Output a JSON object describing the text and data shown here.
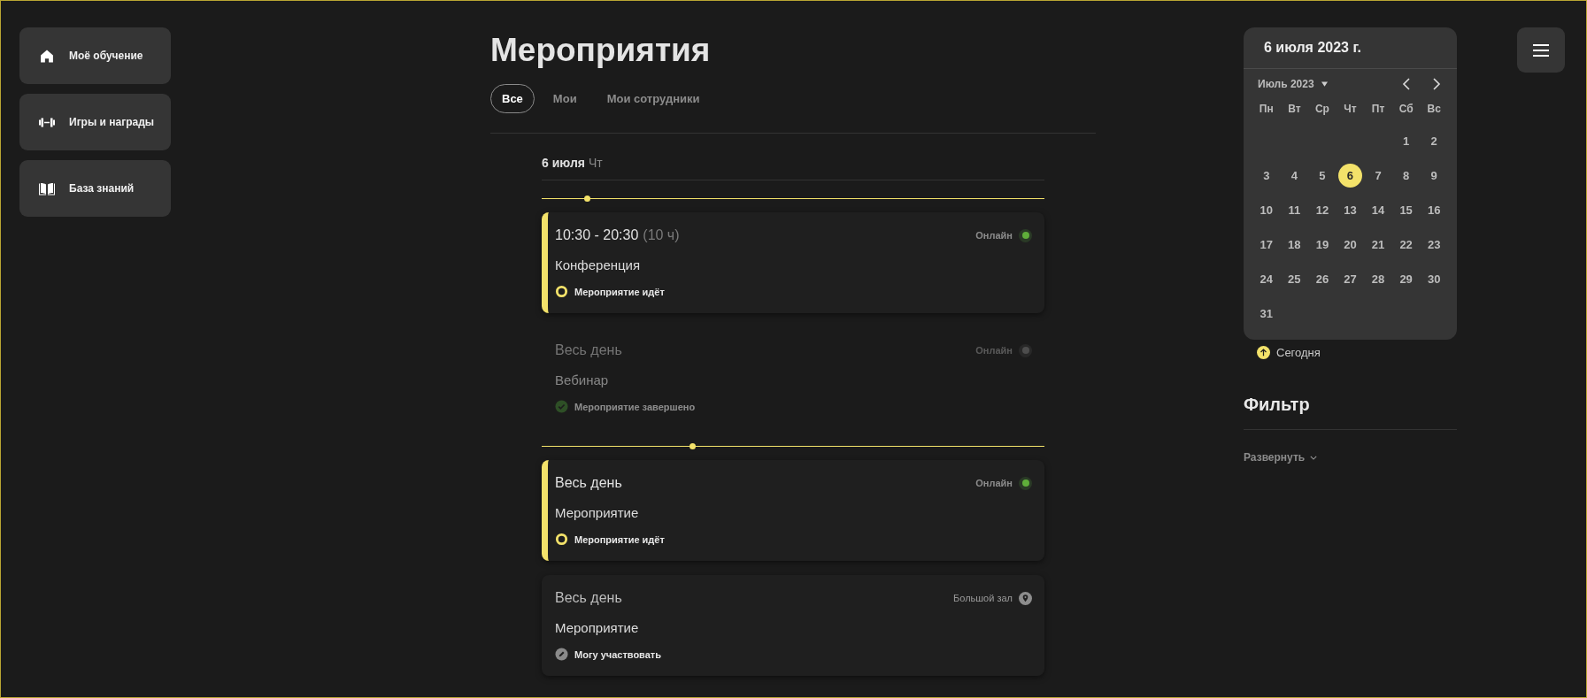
{
  "sidebar": {
    "items": [
      {
        "label": "Моё обучение"
      },
      {
        "label": "Игры и награды"
      },
      {
        "label": "База знаний"
      }
    ]
  },
  "page": {
    "title": "Мероприятия"
  },
  "tabs": [
    {
      "label": "Все",
      "selected": true
    },
    {
      "label": "Мои",
      "selected": false
    },
    {
      "label": "Мои сотрудники",
      "selected": false
    }
  ],
  "day": {
    "date": "6 июля",
    "weekday": "Чт"
  },
  "timeline": [
    {
      "kind": "now",
      "level": 0.09
    },
    {
      "kind": "ongoing",
      "time": "10:30 - 20:30",
      "duration": "(10 ч)",
      "title": "Конференция",
      "status_label": "Мероприятие идёт",
      "place": {
        "kind": "online",
        "label": "Онлайн",
        "active": true
      }
    },
    {
      "kind": "ended",
      "time": "Весь день",
      "title": "Вебинар",
      "status_label": "Мероприятие завершено",
      "place": {
        "kind": "online",
        "label": "Онлайн",
        "active": false
      }
    },
    {
      "kind": "now",
      "level": 0.3
    },
    {
      "kind": "ongoing",
      "time": "Весь день",
      "title": "Мероприятие",
      "status_label": "Мероприятие идёт",
      "place": {
        "kind": "online",
        "label": "Онлайн",
        "active": true
      }
    },
    {
      "kind": "open",
      "time": "Весь день",
      "title": "Мероприятие",
      "status_label": "Могу участвовать",
      "place": {
        "kind": "venue",
        "label": "Большой зал"
      }
    }
  ],
  "calendar": {
    "header": "6 июля 2023 г.",
    "month": "Июль 2023",
    "weekdays": [
      "Пн",
      "Вт",
      "Ср",
      "Чт",
      "Пт",
      "Сб",
      "Вс"
    ],
    "weeks": [
      {
        "kind": "first",
        "days": [
          {
            "label": "1",
            "selected": false
          },
          {
            "label": "2",
            "selected": false
          }
        ]
      },
      {
        "kind": "full",
        "days": [
          {
            "label": "3",
            "selected": false
          },
          {
            "label": "4",
            "selected": false
          },
          {
            "label": "5",
            "selected": false
          },
          {
            "label": "6",
            "selected": true
          },
          {
            "label": "7",
            "selected": false
          },
          {
            "label": "8",
            "selected": false
          },
          {
            "label": "9",
            "selected": false
          }
        ]
      },
      {
        "kind": "full",
        "days": [
          {
            "label": "10",
            "selected": false
          },
          {
            "label": "11",
            "selected": false
          },
          {
            "label": "12",
            "selected": false
          },
          {
            "label": "13",
            "selected": false
          },
          {
            "label": "14",
            "selected": false
          },
          {
            "label": "15",
            "selected": false
          },
          {
            "label": "16",
            "selected": false
          }
        ]
      },
      {
        "kind": "full",
        "days": [
          {
            "label": "17",
            "selected": false
          },
          {
            "label": "18",
            "selected": false
          },
          {
            "label": "19",
            "selected": false
          },
          {
            "label": "20",
            "selected": false
          },
          {
            "label": "21",
            "selected": false
          },
          {
            "label": "22",
            "selected": false
          },
          {
            "label": "23",
            "selected": false
          }
        ]
      },
      {
        "kind": "full",
        "days": [
          {
            "label": "24",
            "selected": false
          },
          {
            "label": "25",
            "selected": false
          },
          {
            "label": "26",
            "selected": false
          },
          {
            "label": "27",
            "selected": false
          },
          {
            "label": "28",
            "selected": false
          },
          {
            "label": "29",
            "selected": false
          },
          {
            "label": "30",
            "selected": false
          }
        ]
      },
      {
        "kind": "last",
        "days": [
          {
            "label": "31",
            "selected": false
          }
        ]
      }
    ],
    "today_label": "Сегодня"
  },
  "filter": {
    "title": "Фильтр",
    "expand_label": "Развернуть"
  }
}
